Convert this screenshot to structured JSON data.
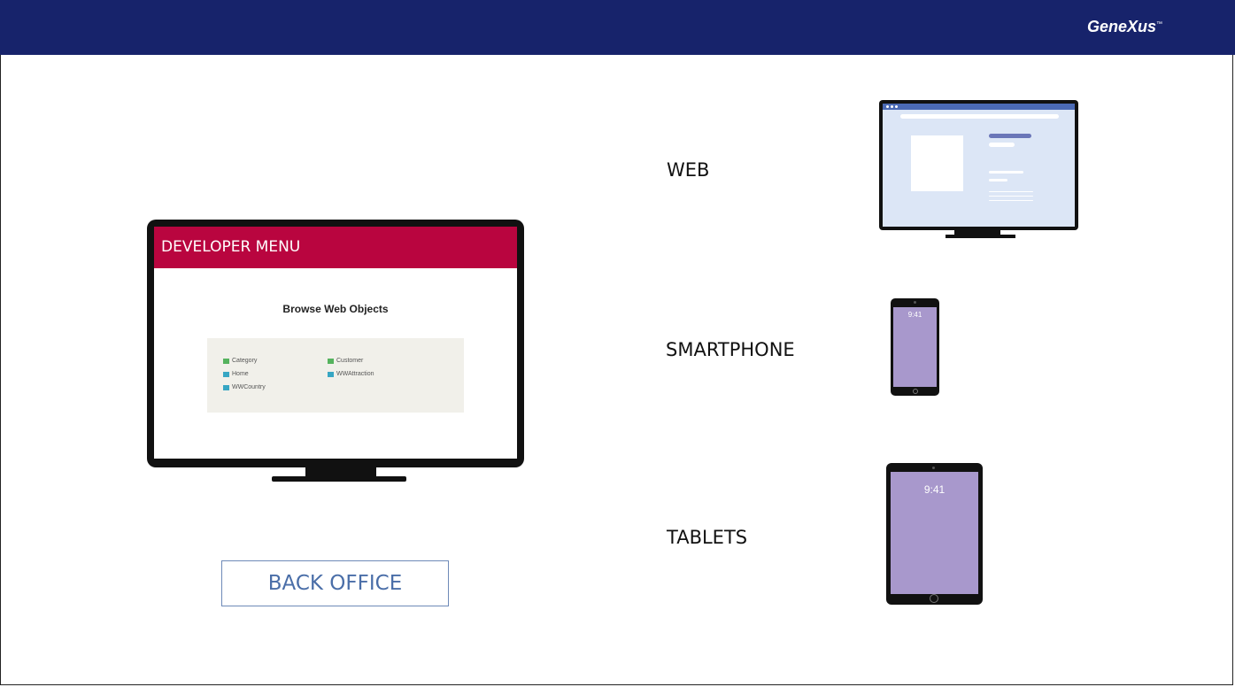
{
  "header": {
    "brand": "GeneXus",
    "brand_mark": "™"
  },
  "backoffice_monitor": {
    "menu_title": "DEVELOPER MENU",
    "page_title": "Browse Web Objects",
    "objects": [
      "Category",
      "Customer",
      "Home",
      "WWAttraction",
      "WWCountry"
    ]
  },
  "backoffice_label": "BACK OFFICE",
  "platforms": {
    "web": "WEB",
    "smartphone": "SMARTPHONE",
    "tablets": "TABLETS"
  },
  "devices": {
    "phone_time": "9:41",
    "tablet_time": "9:41"
  },
  "colors": {
    "header": "#17236b",
    "developer_menu": "#b9053f",
    "device_screen": "#a898cc",
    "web_bar": "#4b6ab5"
  }
}
